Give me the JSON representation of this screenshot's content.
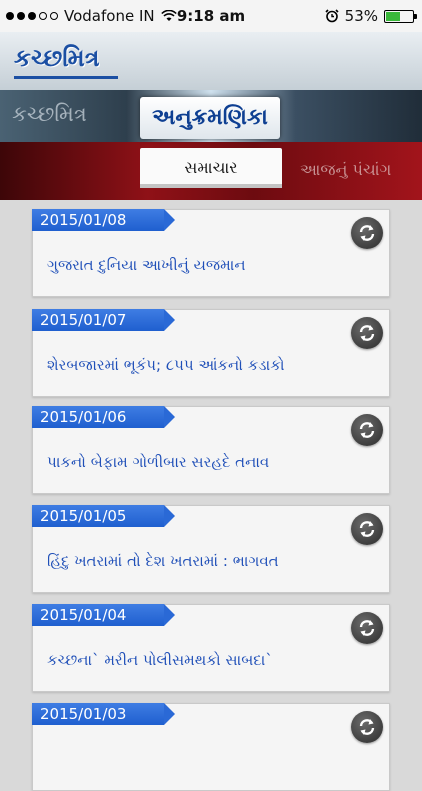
{
  "status_bar": {
    "carrier": "Vodafone IN",
    "time": "9:18 am",
    "battery": "53%",
    "battery_level": 0.53
  },
  "header": {
    "logo_text": "કચ્છમિત્ર"
  },
  "banner": {
    "brand_text": "કચ્છમિત્ર",
    "index_label": "અનુક્રમણિકા",
    "news_label": "સમાચાર",
    "panchang_label": "આજનું પંચાંગ"
  },
  "articles": [
    {
      "date": "2015/01/08",
      "headline": "ગુજરાત દુનિયા આખીનું યજમાન"
    },
    {
      "date": "2015/01/07",
      "headline": "શેરબજારમાં ભૂકંપ; ૮પપ આંકનો કડાકો"
    },
    {
      "date": "2015/01/06",
      "headline": "પાકનો બેફામ ગોળીબાર સરહદે તનાવ"
    },
    {
      "date": "2015/01/05",
      "headline": "હિંદુ ખતરામાં તો દેશ ખતરામાં : ભાગવત"
    },
    {
      "date": "2015/01/04",
      "headline": "કચ્છના` મરીન પોલીસમથકો સાબદા`"
    },
    {
      "date": "2015/01/03",
      "headline": ""
    }
  ],
  "colors": {
    "accent": "#1f5fcf",
    "headline": "#1f4fb8",
    "banner_red": "#8f1117",
    "battery_green": "#39b83a"
  }
}
